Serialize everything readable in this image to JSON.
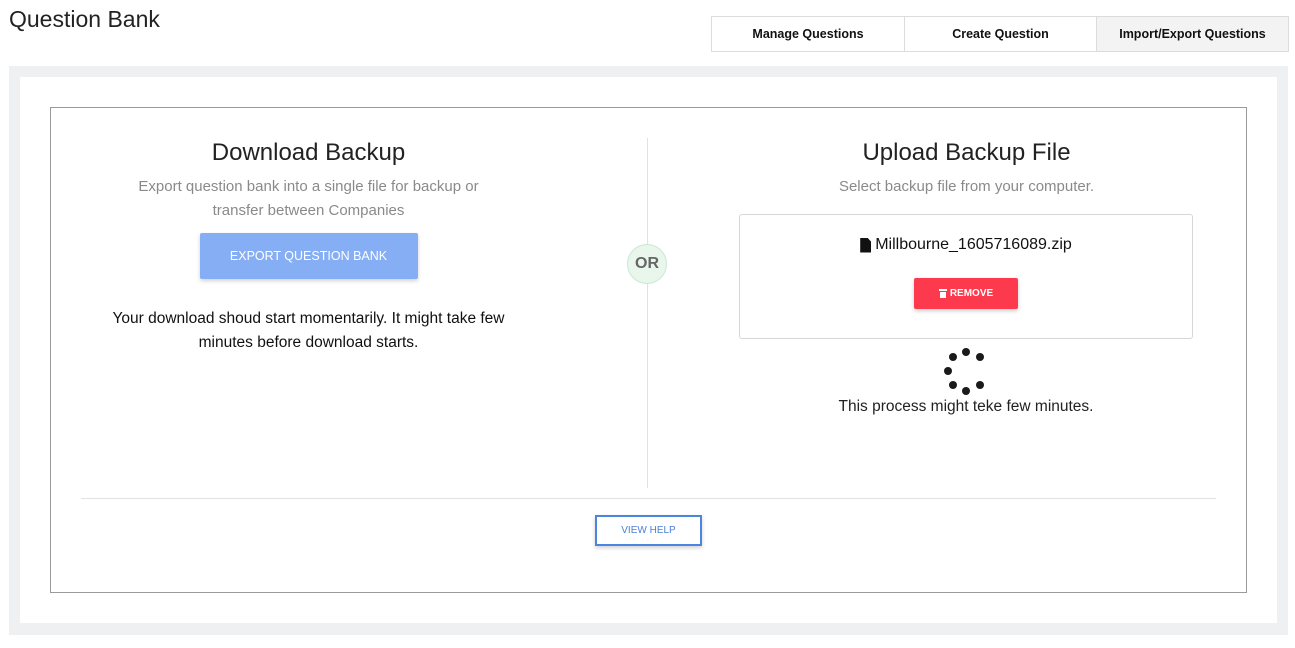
{
  "page": {
    "title": "Question Bank"
  },
  "tabs": [
    {
      "label": "Manage Questions",
      "active": false
    },
    {
      "label": "Create Question",
      "active": false
    },
    {
      "label": "Import/Export Questions",
      "active": true
    }
  ],
  "download": {
    "title": "Download Backup",
    "description": "Export question bank into a single file for backup or transfer between Companies",
    "button_label": "EXPORT QUESTION BANK",
    "note": "Your download shoud start momentarily. It might take few minutes before download starts."
  },
  "or_label": "OR",
  "upload": {
    "title": "Upload Backup File",
    "description": "Select backup file from your computer.",
    "file_name": "Millbourne_1605716089.zip",
    "remove_label": "REMOVE",
    "process_note": "This process might teke few minutes."
  },
  "help": {
    "label": "VIEW HELP"
  },
  "icons": {
    "file": "file-icon",
    "trash": "trash-icon",
    "spinner": "loading-spinner"
  },
  "colors": {
    "export_button": "#86aef5",
    "remove_button": "#fd3a4d",
    "help_border": "#4a86e0",
    "or_badge_bg": "#e8f6ec"
  }
}
